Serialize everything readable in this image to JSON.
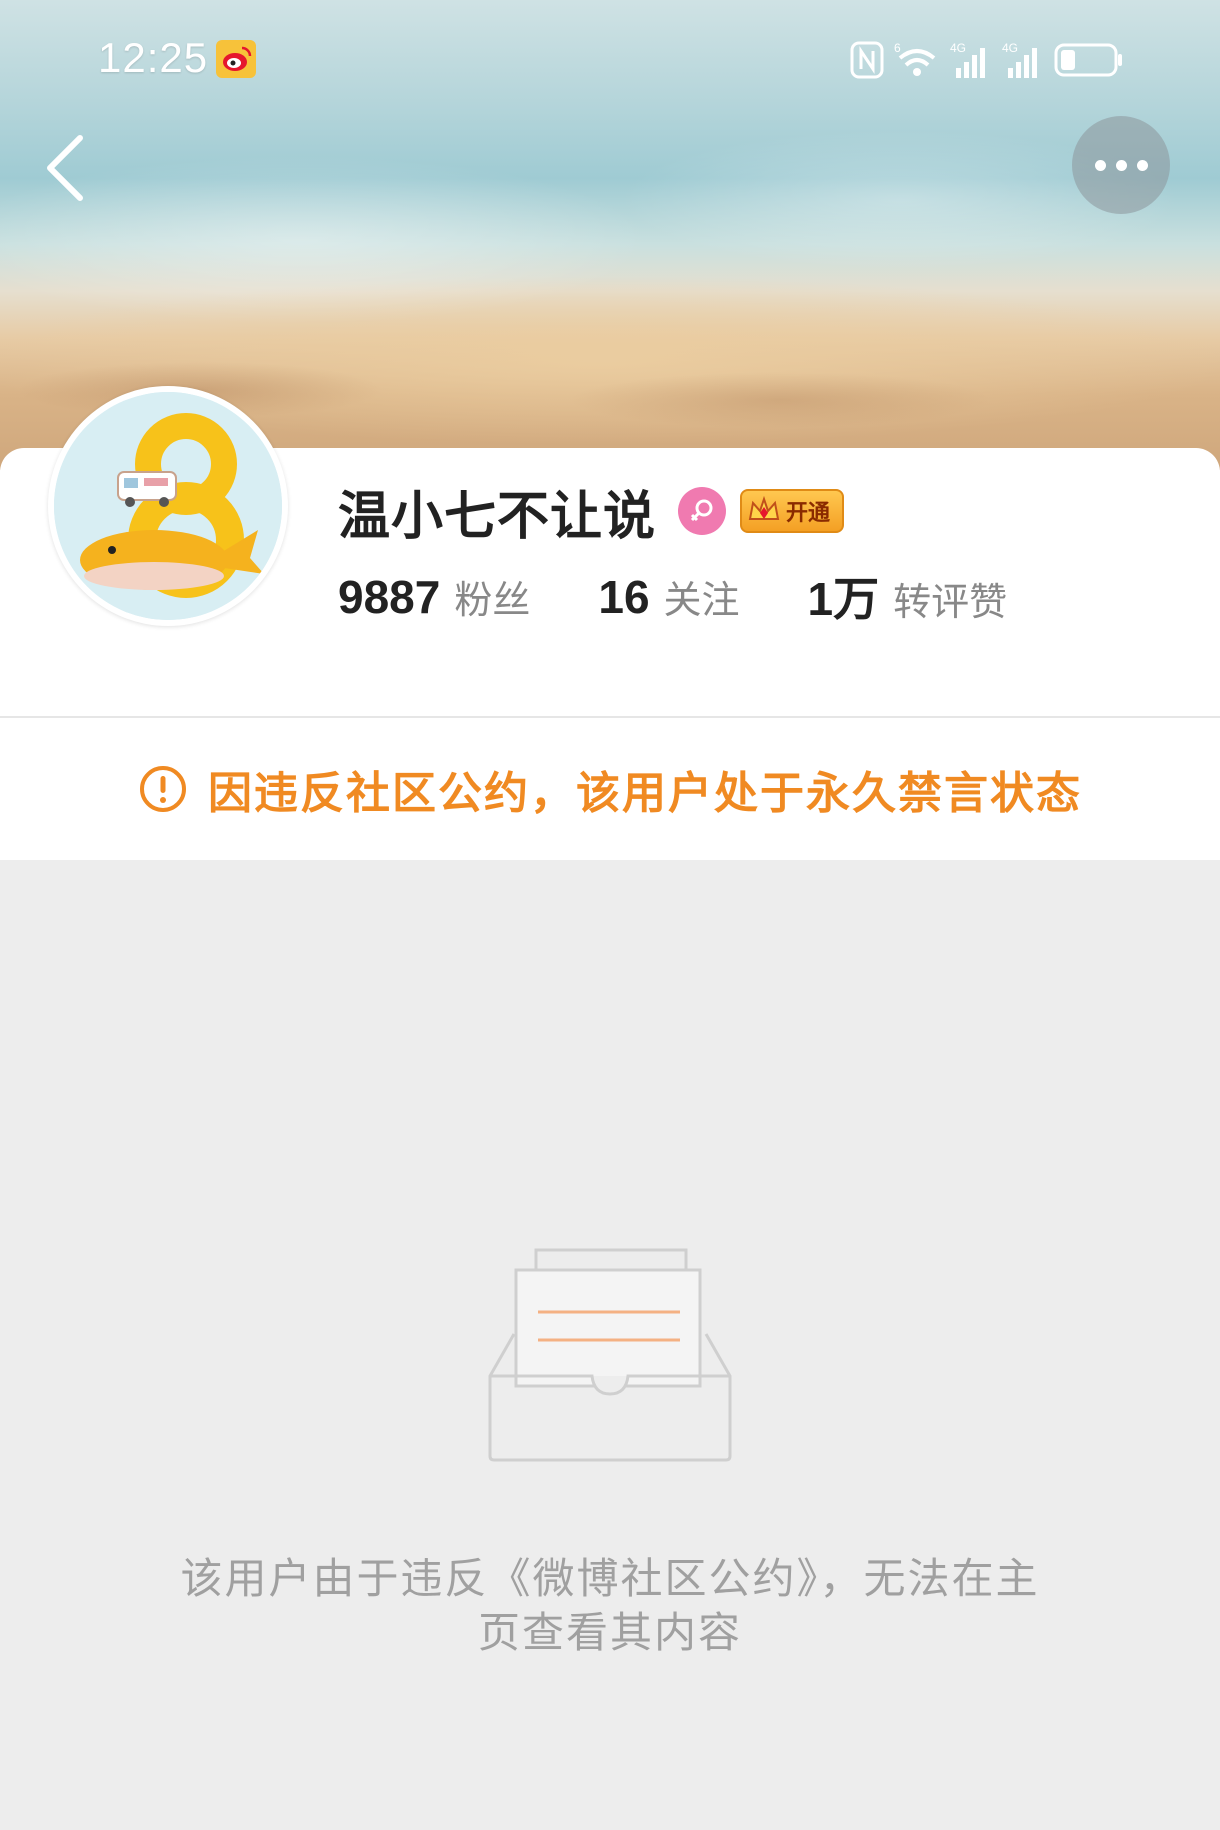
{
  "status_bar": {
    "time": "12:25",
    "app_icon": "weibo-icon",
    "indicators": [
      "nfc-icon",
      "wifi-6-icon",
      "signal-4g-icon",
      "signal-4g-icon",
      "battery-icon"
    ],
    "network_label_1": "4G",
    "network_label_2": "4G",
    "wifi_label": "6"
  },
  "navigation": {
    "back_icon": "chevron-left-icon",
    "more_icon": "more-horizontal-icon"
  },
  "profile": {
    "username": "温小七不让说",
    "gender_icon": "female-icon",
    "vip_badge_label": "开通",
    "stats": [
      {
        "value": "9887",
        "label": "粉丝"
      },
      {
        "value": "16",
        "label": "关注"
      },
      {
        "value": "1万",
        "label": "转评赞"
      }
    ]
  },
  "notice": {
    "icon": "warning-circle-icon",
    "text": "因违反社区公约，该用户处于永久禁言状态"
  },
  "empty_state": {
    "icon": "empty-inbox-icon",
    "line1": "该用户由于违反《微博社区公约》，无法在主",
    "line2": "页查看其内容"
  },
  "colors": {
    "accent_orange": "#f08a22",
    "page_background": "#ededed",
    "card_background": "#ffffff",
    "gender_pink": "#f07ab0"
  }
}
